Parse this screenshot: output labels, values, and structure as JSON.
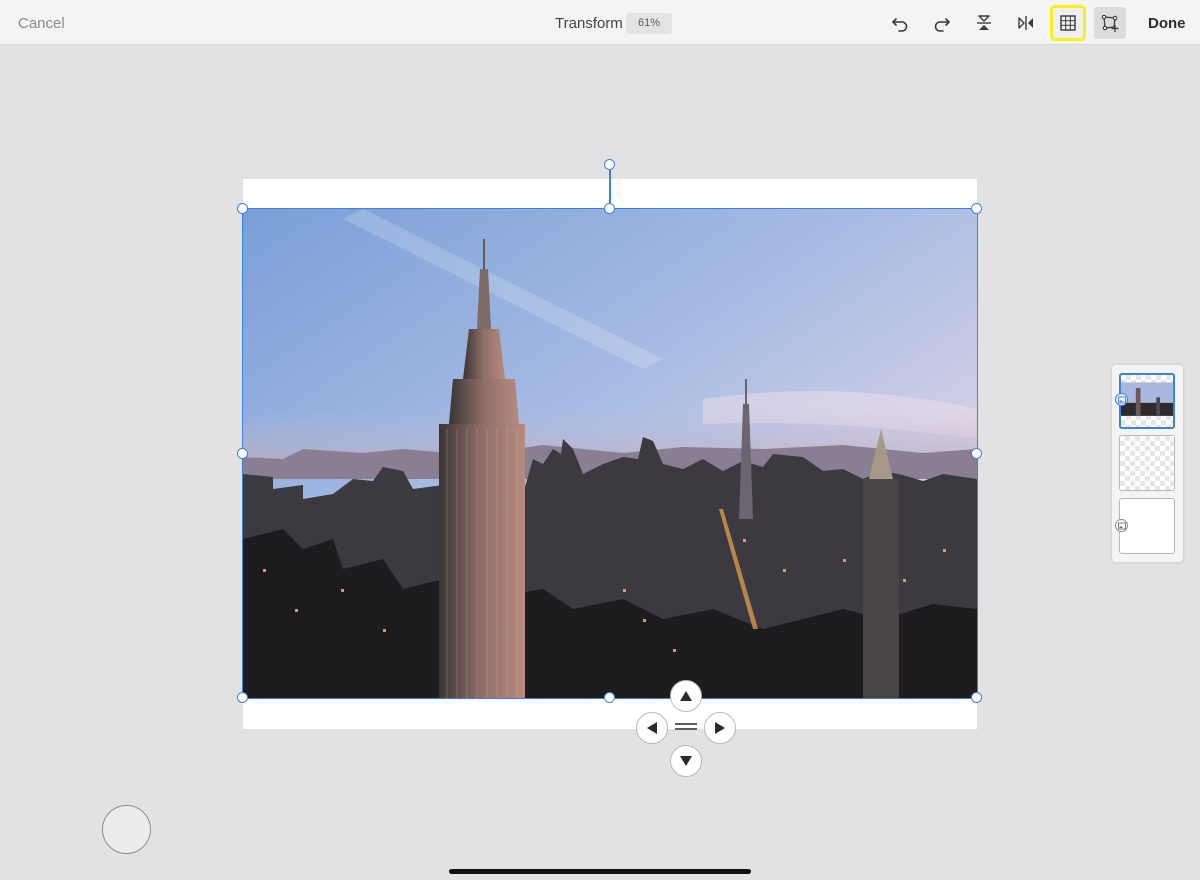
{
  "toolbar": {
    "cancel_label": "Cancel",
    "title": "Transform",
    "zoom": "61%",
    "done_label": "Done",
    "tools": [
      {
        "name": "undo-icon"
      },
      {
        "name": "redo-icon"
      },
      {
        "name": "flip-vertical-icon"
      },
      {
        "name": "flip-horizontal-icon"
      },
      {
        "name": "grid-icon",
        "highlighted": true
      },
      {
        "name": "free-transform-icon",
        "active": true
      }
    ]
  },
  "canvas": {
    "image_subject": "New York City skyline with Empire State Building at sunset",
    "selection_color": "#3c82d8"
  },
  "nudge": {
    "icons": [
      "arrow-up-icon",
      "arrow-left-icon",
      "arrow-right-icon",
      "arrow-down-icon"
    ]
  },
  "layers": {
    "items": [
      {
        "type": "image",
        "selected": true
      },
      {
        "type": "empty",
        "selected": false
      },
      {
        "type": "background",
        "selected": false
      }
    ]
  },
  "colors": {
    "accent": "#3c82d8",
    "highlight": "#f7f01a",
    "toolbar_bg": "#f4f4f5",
    "workspace_bg": "#e2e1e3"
  }
}
